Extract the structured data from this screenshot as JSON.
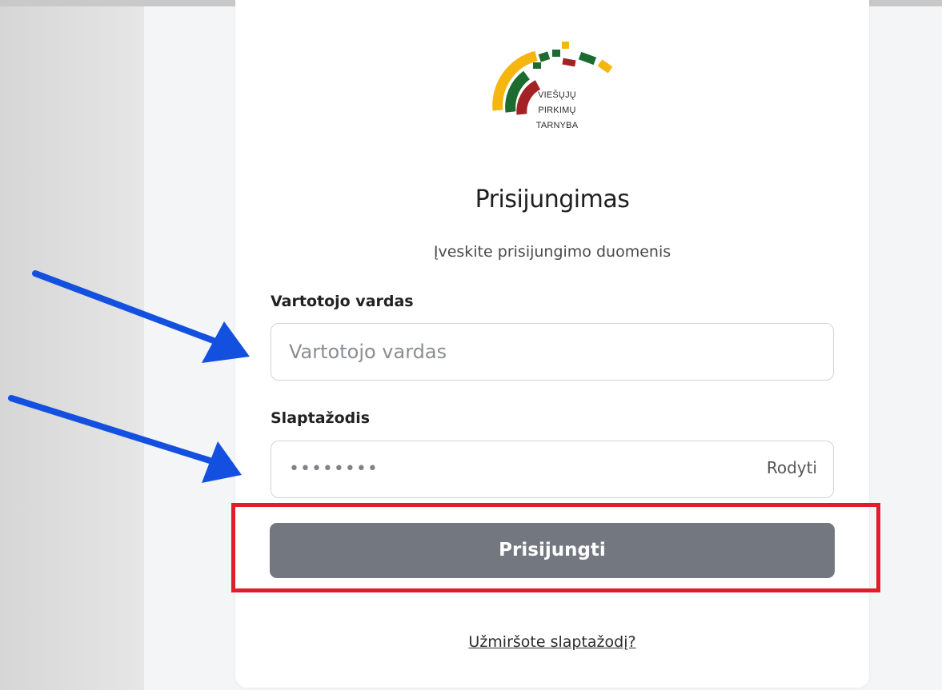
{
  "logo": {
    "lines": [
      "VIEŠŲJŲ",
      "PIRKIMŲ",
      "TARNYBA"
    ],
    "colors": {
      "yellow": "#f5b70f",
      "green": "#1c6b2f",
      "red": "#a32226"
    }
  },
  "login": {
    "title": "Prisijungimas",
    "subtitle": "Įveskite prisijungimo duomenis",
    "username": {
      "label": "Vartotojo vardas",
      "placeholder": "Vartotojo vardas",
      "value": ""
    },
    "password": {
      "label": "Slaptažodis",
      "masked_value": "••••••••",
      "show_label": "Rodyti"
    },
    "submit_label": "Prisijungti",
    "forgot_label": "Užmiršote slaptažodį?"
  },
  "annotations": {
    "arrow_color": "#1450e0",
    "highlight_color": "#e21d2a",
    "arrow_icon": "arrow-right-down-icon"
  }
}
